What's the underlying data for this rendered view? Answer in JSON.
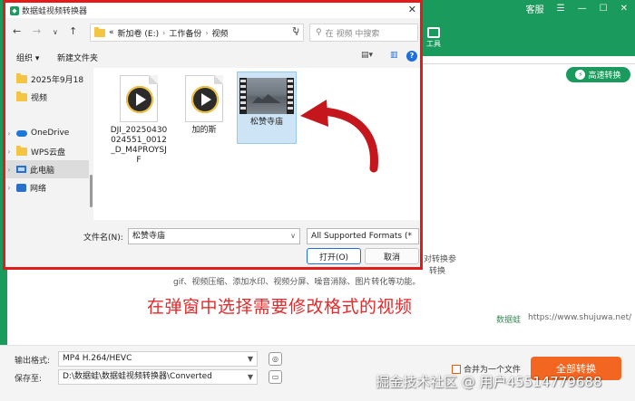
{
  "app": {
    "window_controls": {
      "service": "客服"
    },
    "toolbar_label": "工具",
    "fast_convert": "高速转换",
    "desc_lines": [
      "对转换参",
      "转换",
      "gif、视频压缩、添加水印、视频分屏、噪音消除、图片转化等功能。"
    ],
    "annotation": "在弹窗中选择需要修改格式的视频",
    "brand": "数据蛙",
    "url": "https://www.shujuwa.net/",
    "output_format_label": "输出格式:",
    "output_format_value": "MP4 H.264/HEVC",
    "save_to_label": "保存至:",
    "save_to_value": "D:\\数据蛙\\数据蛙视频转换器\\Converted",
    "merge_label": "合并为一个文件",
    "convert_all": "全部转换",
    "watermark": "掘金技术社区 @ 用户45514779688"
  },
  "dialog": {
    "title": "数据蛙视频转换器",
    "address": {
      "ellipsis": "«",
      "segments": [
        "新加卷 (E:)",
        "工作备份",
        "视频"
      ]
    },
    "search_placeholder": "在 视频 中搜索",
    "organize": "组织",
    "new_folder": "新建文件夹",
    "nav_items": [
      {
        "label": "2025年9月18",
        "type": "folder"
      },
      {
        "label": "视频",
        "type": "folder"
      },
      {
        "label": "OneDrive",
        "type": "cloud"
      },
      {
        "label": "WPS云盘",
        "type": "folder"
      },
      {
        "label": "此电脑",
        "type": "pc",
        "selected": true
      },
      {
        "label": "网络",
        "type": "network"
      }
    ],
    "files": [
      {
        "name": "DJI_20250430024551_0012_D_M4PROYSJF",
        "kind": "video"
      },
      {
        "name": "加的斯",
        "kind": "video"
      },
      {
        "name": "松赞寺庙",
        "kind": "thumbnail",
        "selected": true
      }
    ],
    "file_name_label": "文件名(N):",
    "file_name_value": "松赞寺庙",
    "file_type": "All Supported Formats (*",
    "open_button": "打开(O)",
    "cancel_button": "取消"
  },
  "colors": {
    "brand_green": "#1a9a5c",
    "highlight_red": "#e31b1b",
    "convert_orange": "#f26622",
    "selection_blue": "#cde4f7"
  }
}
